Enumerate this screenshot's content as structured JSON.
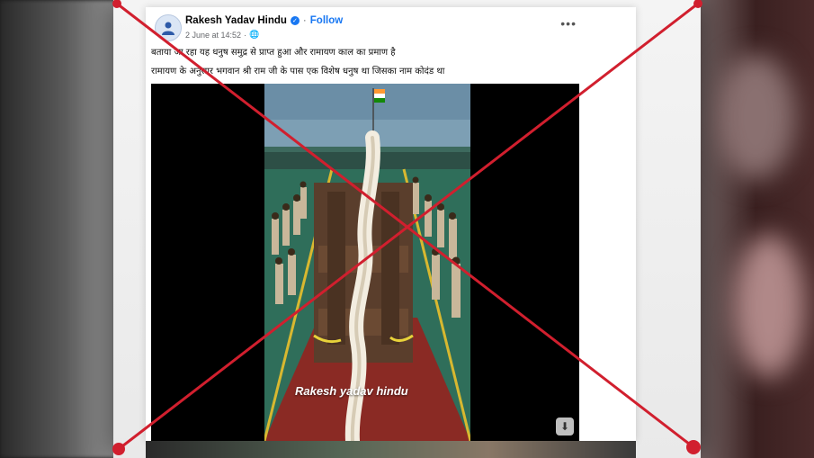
{
  "post": {
    "author_name": "Rakesh Yadav Hindu",
    "follow_label": "Follow",
    "timestamp": "2 June at 14:52",
    "more_label": "•••",
    "caption_line1": "बताया जा रहा यह धनुष समुद्र से प्राप्त हुआ और रामायण काल का प्रमाण है",
    "caption_line2": "रामायण के अनुसार भगवान श्री राम जी के पास एक विशेष धनुष था जिसका नाम कोदंड था",
    "video_watermark": "Rakesh yadav hindu"
  },
  "overlay": {
    "cross_color": "#d11f2e",
    "meaning": "fact-check false marker"
  },
  "colors": {
    "follow_blue": "#1877f2",
    "deck_green": "#2f6e5a",
    "deck_red": "#8a2a24"
  }
}
